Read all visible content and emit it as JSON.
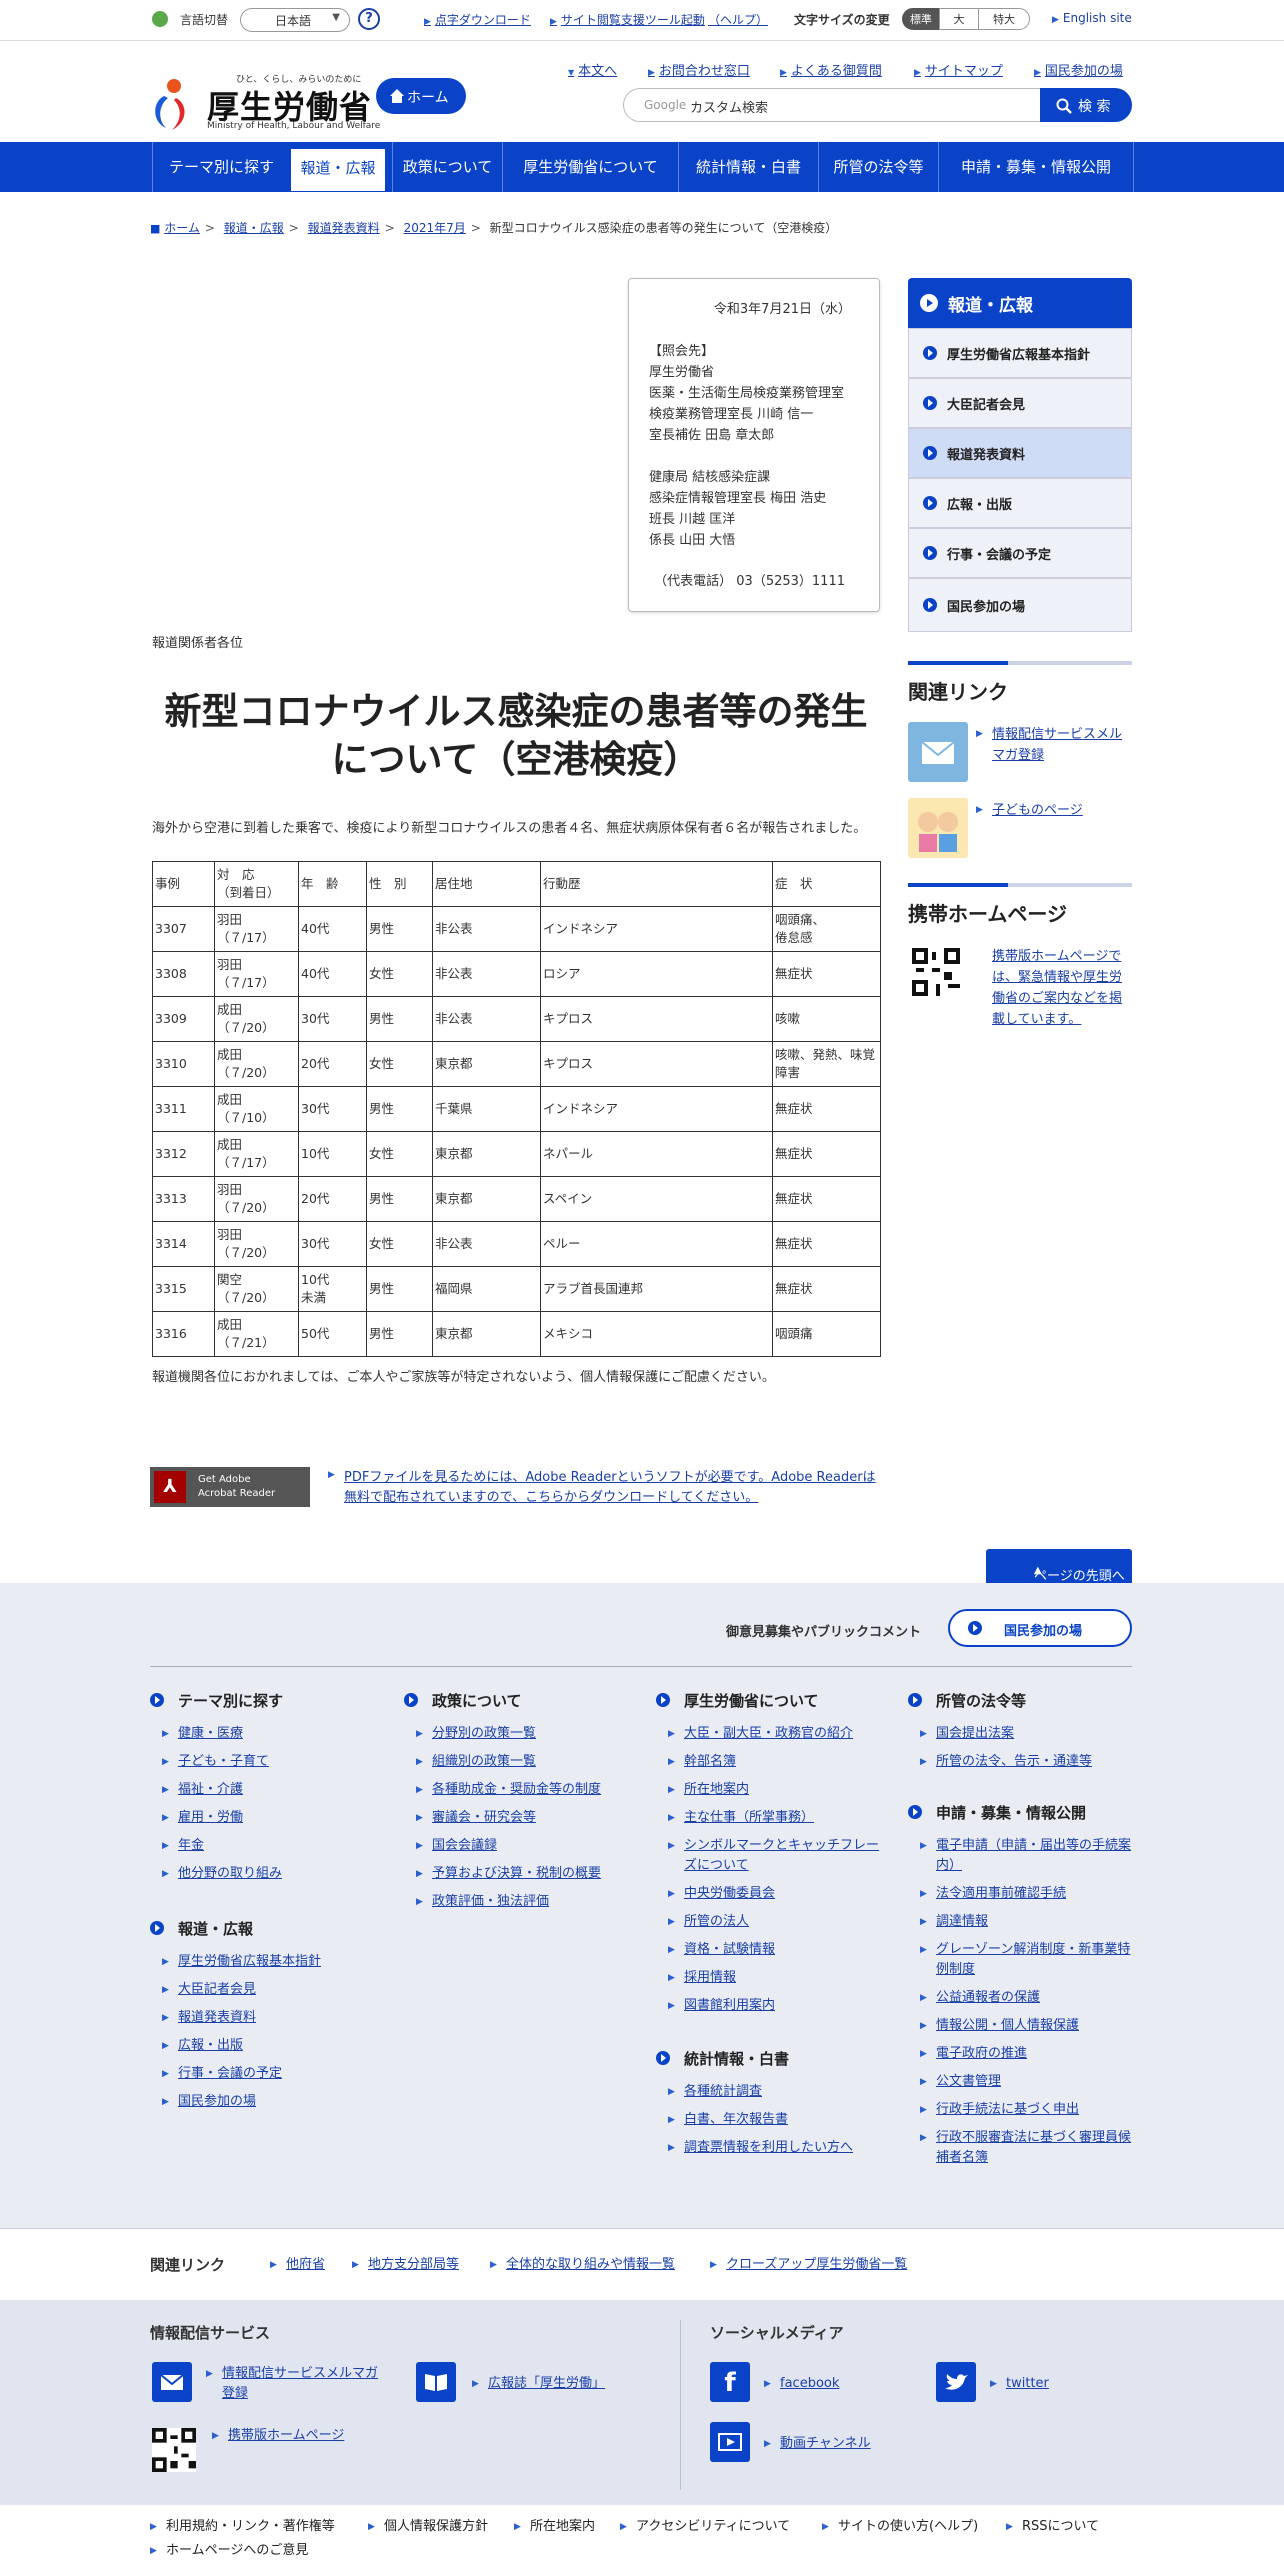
{
  "util": {
    "lang_label": "言語切替",
    "lang_value": "日本語",
    "help_glyph": "?",
    "tenji": "点字ダウンロード",
    "tool": "サイト閲覧支援ツール起動",
    "tool_help": "（ヘルプ）",
    "fontsize_label": "文字サイズの変更",
    "fs_standard": "標準",
    "fs_large": "大",
    "fs_xlarge": "特大",
    "english": "English site"
  },
  "header": {
    "tagline": "ひと、くらし、みらいのために",
    "title": "厚生労働省",
    "subtitle": "Ministry of Health, Labour and Welfare",
    "home": "ホーム",
    "nav": [
      "本文へ",
      "お問合わせ窓口",
      "よくある御質問",
      "サイトマップ",
      "国民参加の場"
    ],
    "search_brand": "Google",
    "search_placeholder": "カスタム検索",
    "search_button": "検 索"
  },
  "gnav": [
    "テーマ別に探す",
    "報道・広報",
    "政策について",
    "厚生労働省について",
    "統計情報・白書",
    "所管の法令等",
    "申請・募集・情報公開"
  ],
  "breadcrumb": [
    "ホーム",
    "報道・広報",
    "報道発表資料",
    "2021年7月",
    "新型コロナウイルス感染症の患者等の発生について（空港検疫）"
  ],
  "contact": {
    "date": "令和3年7月21日（水）",
    "lines": [
      "【照会先】",
      "厚生労働省",
      "医薬・生活衛生局検疫業務管理室",
      "検疫業務管理室長 川崎 信一",
      "室長補佐 田島 章太郎",
      "",
      "健康局 結核感染症課",
      "感染症情報管理室長 梅田 浩史",
      "班長 川越 匡洋",
      "係長 山田 大悟"
    ],
    "phone": "（代表電話） 03（5253）1111"
  },
  "article": {
    "press": "報道関係者各位",
    "title_line1": "新型コロナウイルス感染症の患者等の発生",
    "title_line2": "について（空港検疫）",
    "lead": "海外から空港に到着した乗客で、検疫により新型コロナウイルスの患者４名、無症状病原体保有者６名が報告されました。",
    "note": "報道機関各位におかれましては、ご本人やご家族等が特定されないよう、個人情報保護にご配慮ください。",
    "table_head": [
      "事例",
      "対　応\n（到着日）",
      "年　齢",
      "性　別",
      "居住地",
      "行動歴",
      "症　状"
    ],
    "rows": [
      [
        "3307",
        "羽田\n（７/17）",
        "40代",
        "男性",
        "非公表",
        "インドネシア",
        "咽頭痛、\n倦怠感"
      ],
      [
        "3308",
        "羽田\n（７/17）",
        "40代",
        "女性",
        "非公表",
        "ロシア",
        "無症状"
      ],
      [
        "3309",
        "成田\n（７/20）",
        "30代",
        "男性",
        "非公表",
        "キプロス",
        "咳嗽"
      ],
      [
        "3310",
        "成田\n（７/20）",
        "20代",
        "女性",
        "東京都",
        "キプロス",
        "咳嗽、発熱、味覚障害"
      ],
      [
        "3311",
        "成田\n（７/10）",
        "30代",
        "男性",
        "千葉県",
        "インドネシア",
        "無症状"
      ],
      [
        "3312",
        "成田\n（７/17）",
        "10代",
        "女性",
        "東京都",
        "ネパール",
        "無症状"
      ],
      [
        "3313",
        "羽田\n（７/20）",
        "20代",
        "男性",
        "東京都",
        "スペイン",
        "無症状"
      ],
      [
        "3314",
        "羽田\n（７/20）",
        "30代",
        "女性",
        "非公表",
        "ペルー",
        "無症状"
      ],
      [
        "3315",
        "関空\n（７/20）",
        "10代\n未満",
        "男性",
        "福岡県",
        "アラブ首長国連邦",
        "無症状"
      ],
      [
        "3316",
        "成田\n（７/21）",
        "50代",
        "男性",
        "東京都",
        "メキシコ",
        "咽頭痛"
      ]
    ],
    "acrobat_line1": "Get Adobe",
    "acrobat_line2": "Acrobat Reader",
    "pdf_text": "PDFファイルを見るためには、Adobe Readerというソフトが必要です。Adobe Readerは無料で配布されていますので、こちらからダウンロードしてください。",
    "to_top": "ページの先頭へ"
  },
  "sidebar": {
    "head": "報道・広報",
    "items": [
      "厚生労働省広報基本指針",
      "大臣記者会見",
      "報道発表資料",
      "広報・出版",
      "行事・会議の予定",
      "国民参加の場"
    ],
    "related_title": "関連リンク",
    "related": [
      "情報配信サービスメルマガ登録",
      "子どものページ"
    ],
    "mobile_title": "携帯ホームページ",
    "mobile_text": "携帯版ホームページでは、緊急情報や厚生労働省のご案内などを掲載しています。"
  },
  "footer": {
    "opinion": "御意見募集やパブリックコメント",
    "sanka": "国民参加の場",
    "cols": [
      {
        "title": "テーマ別に探す",
        "links": [
          "健康・医療",
          "子ども・子育て",
          "福祉・介護",
          "雇用・労働",
          "年金",
          "他分野の取り組み"
        ]
      },
      {
        "title": "報道・広報",
        "links": [
          "厚生労働省広報基本指針",
          "大臣記者会見",
          "報道発表資料",
          "広報・出版",
          "行事・会議の予定",
          "国民参加の場"
        ]
      },
      {
        "title": "政策について",
        "links": [
          "分野別の政策一覧",
          "組織別の政策一覧",
          "各種助成金・奨励金等の制度",
          "審議会・研究会等",
          "国会会議録",
          "予算および決算・税制の概要",
          "政策評価・独法評価"
        ]
      },
      {
        "title": "厚生労働省について",
        "links": [
          "大臣・副大臣・政務官の紹介",
          "幹部名簿",
          "所在地案内",
          "主な仕事（所掌事務）",
          "シンボルマークとキャッチフレーズについて",
          "中央労働委員会",
          "所管の法人",
          "資格・試験情報",
          "採用情報",
          "図書館利用案内"
        ]
      },
      {
        "title": "統計情報・白書",
        "links": [
          "各種統計調査",
          "白書、年次報告書",
          "調査票情報を利用したい方へ"
        ]
      },
      {
        "title": "所管の法令等",
        "links": [
          "国会提出法案",
          "所管の法令、告示・通達等"
        ]
      },
      {
        "title": "申請・募集・情報公開",
        "links": [
          "電子申請（申請・届出等の手続案内）",
          "法令適用事前確認手続",
          "調達情報",
          "グレーゾーン解消制度・新事業特例制度",
          "公益通報者の保護",
          "情報公開・個人情報保護",
          "電子政府の推進",
          "公文書管理",
          "行政手続法に基づく申出",
          "行政不服審査法に基づく審理員候補者名簿"
        ]
      }
    ],
    "related_label": "関連リンク",
    "related_links": [
      "他府省",
      "地方支分部局等",
      "全体的な取り組みや情報一覧",
      "クローズアップ厚生労働省一覧"
    ],
    "info_title": "情報配信サービス",
    "info_links": [
      "情報配信サービスメルマガ登録",
      "広報誌「厚生労働」",
      "携帯版ホームページ"
    ],
    "social_title": "ソーシャルメディア",
    "social_links": [
      "facebook",
      "twitter",
      "動画チャンネル"
    ],
    "bottom_links": [
      "利用規約・リンク・著作権等",
      "個人情報保護方針",
      "所在地案内",
      "アクセシビリティについて",
      "サイトの使い方(ヘルプ)",
      "RSSについて",
      "ホームページへのご意見"
    ]
  },
  "colors": {
    "brand": "#0a43c8",
    "footer_bg": "#e9ecf3"
  }
}
